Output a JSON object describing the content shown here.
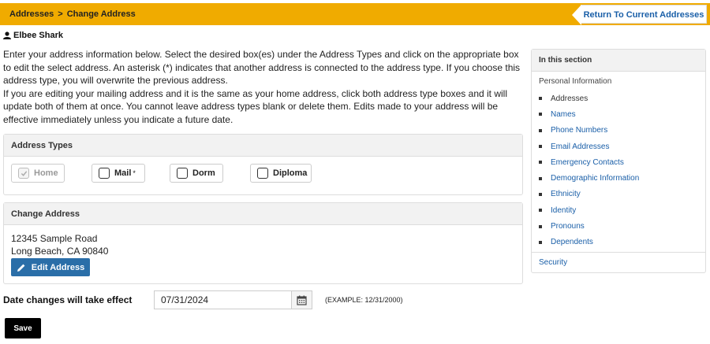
{
  "breadcrumb": {
    "parent": "Addresses",
    "separator": ">",
    "current": "Change Address"
  },
  "return_button": "Return To Current Addresses",
  "user": {
    "name": "Elbee Shark",
    "icon": "user-icon"
  },
  "intro": {
    "p1": "Enter your address information below. Select the desired box(es) under the Address Types and click on the appropriate box to edit the select address. An asterisk (*) indicates that another address is connected to the address type.  If you choose this address type, you will overwrite the previous address.",
    "p2": "If you are editing your mailing address and it is the same as your home address, click both address type boxes and it will update both of them at once.  You cannot leave address types blank or delete them.  Edits made to your address will be effective immediately unless you indicate a future date."
  },
  "address_types": {
    "title": "Address Types",
    "items": [
      {
        "label": "Home",
        "checked": true,
        "disabled": true,
        "asterisk": ""
      },
      {
        "label": "Mail",
        "checked": false,
        "disabled": false,
        "asterisk": "*"
      },
      {
        "label": "Dorm",
        "checked": false,
        "disabled": false,
        "asterisk": ""
      },
      {
        "label": "Diploma",
        "checked": false,
        "disabled": false,
        "asterisk": ""
      }
    ]
  },
  "change_address": {
    "title": "Change Address",
    "line1": "12345 Sample Road",
    "line2": "Long Beach, CA 90840",
    "edit_button": "Edit Address"
  },
  "effective_date": {
    "label": "Date changes will take effect",
    "value": "07/31/2024",
    "example": "(EXAMPLE: 12/31/2000)",
    "icon": "calendar-icon"
  },
  "save_button": "Save",
  "sidebar": {
    "title": "In this section",
    "group": "Personal Information",
    "items": [
      "Addresses",
      "Names",
      "Phone Numbers",
      "Email Addresses",
      "Emergency Contacts",
      "Demographic Information",
      "Ethnicity",
      "Identity",
      "Pronouns",
      "Dependents"
    ],
    "security": "Security"
  },
  "colors": {
    "header": "#f0ab00",
    "link": "#1a5fa8",
    "button": "#2a6ea8"
  }
}
